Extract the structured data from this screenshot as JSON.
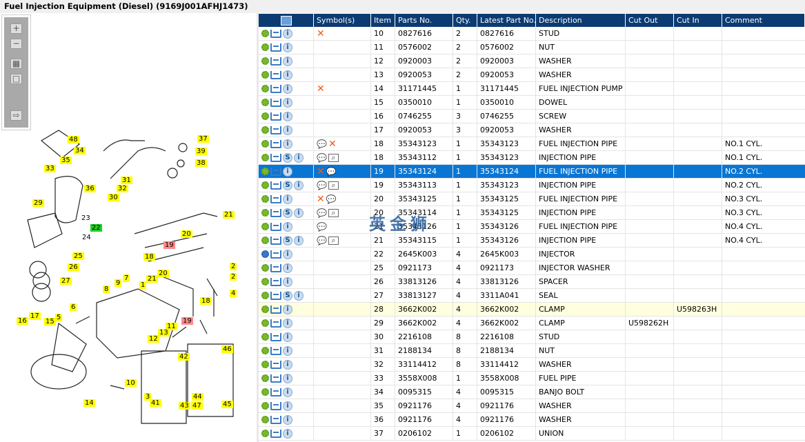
{
  "title": "Fuel Injection Equipment (Diesel) (9169J001AFHJ1473)",
  "toolbar": {
    "zoom_in": "+",
    "zoom_out": "−",
    "fit": "▦",
    "actual": "□",
    "export": "⇨"
  },
  "callouts": [
    "48",
    "34",
    "35",
    "33",
    "37",
    "39",
    "38",
    "31",
    "32",
    "36",
    "30",
    "29",
    "23",
    "22",
    "24",
    "21",
    "20",
    "19",
    "18",
    "25",
    "26",
    "27",
    "2",
    "2",
    "4",
    "7",
    "9",
    "8",
    "1",
    "21",
    "20",
    "18",
    "6",
    "17",
    "16",
    "15",
    "5",
    "19",
    "11",
    "13",
    "12",
    "10",
    "14",
    "42",
    "46",
    "3",
    "41",
    "44",
    "47",
    "45",
    "43"
  ],
  "columns": [
    "",
    "Symbol(s)",
    "Item",
    "Parts No.",
    "Qty.",
    "Latest Part No.",
    "Description",
    "Cut Out",
    "Cut In",
    "Comment"
  ],
  "rows": [
    {
      "icons": "g,c,i",
      "sym": "x",
      "item": "10",
      "part": "0827616",
      "qty": "2",
      "latest": "0827616",
      "desc": "STUD",
      "out": "",
      "in": "",
      "comment": ""
    },
    {
      "icons": "g,c,i",
      "sym": "",
      "item": "11",
      "part": "0576002",
      "qty": "2",
      "latest": "0576002",
      "desc": "NUT",
      "out": "",
      "in": "",
      "comment": ""
    },
    {
      "icons": "g,c,i",
      "sym": "",
      "item": "12",
      "part": "0920003",
      "qty": "2",
      "latest": "0920003",
      "desc": "WASHER",
      "out": "",
      "in": "",
      "comment": ""
    },
    {
      "icons": "g,c,i",
      "sym": "",
      "item": "13",
      "part": "0920053",
      "qty": "2",
      "latest": "0920053",
      "desc": "WASHER",
      "out": "",
      "in": "",
      "comment": ""
    },
    {
      "icons": "g,c,i",
      "sym": "x",
      "item": "14",
      "part": "31171445",
      "qty": "1",
      "latest": "31171445",
      "desc": "FUEL INJECTION PUMP G",
      "out": "",
      "in": "",
      "comment": ""
    },
    {
      "icons": "g,c,i",
      "sym": "",
      "item": "15",
      "part": "0350010",
      "qty": "1",
      "latest": "0350010",
      "desc": "DOWEL",
      "out": "",
      "in": "",
      "comment": ""
    },
    {
      "icons": "g,c,i",
      "sym": "",
      "item": "16",
      "part": "0746255",
      "qty": "3",
      "latest": "0746255",
      "desc": "SCREW",
      "out": "",
      "in": "",
      "comment": ""
    },
    {
      "icons": "g,c,i",
      "sym": "",
      "item": "17",
      "part": "0920053",
      "qty": "3",
      "latest": "0920053",
      "desc": "WASHER",
      "out": "",
      "in": "",
      "comment": ""
    },
    {
      "icons": "g,c,i",
      "sym": "b,x",
      "item": "18",
      "part": "35343123",
      "qty": "1",
      "latest": "35343123",
      "desc": "FUEL INJECTION PIPE",
      "out": "",
      "in": "",
      "comment": "NO.1 CYL."
    },
    {
      "icons": "g,c,s,i",
      "sym": "b,k",
      "item": "18",
      "part": "35343112",
      "qty": "1",
      "latest": "35343123",
      "desc": "INJECTION PIPE",
      "out": "",
      "in": "",
      "comment": "NO.1 CYL."
    },
    {
      "icons": "g,c,i",
      "sym": "x,b",
      "item": "19",
      "part": "35343124",
      "qty": "1",
      "latest": "35343124",
      "desc": "FUEL INJECTION PIPE",
      "out": "",
      "in": "",
      "comment": "NO.2 CYL.",
      "state": "sel"
    },
    {
      "icons": "g,c,s,i",
      "sym": "b,k",
      "item": "19",
      "part": "35343113",
      "qty": "1",
      "latest": "35343123",
      "desc": "INJECTION PIPE",
      "out": "",
      "in": "",
      "comment": "NO.2 CYL."
    },
    {
      "icons": "g,c,i",
      "sym": "x,b",
      "item": "20",
      "part": "35343125",
      "qty": "1",
      "latest": "35343125",
      "desc": "FUEL INJECTION PIPE",
      "out": "",
      "in": "",
      "comment": "NO.3 CYL."
    },
    {
      "icons": "g,c,s,i",
      "sym": "b,k",
      "item": "20",
      "part": "35343114",
      "qty": "1",
      "latest": "35343125",
      "desc": "INJECTION PIPE",
      "out": "",
      "in": "",
      "comment": "NO.3 CYL."
    },
    {
      "icons": "g,c,i",
      "sym": "b",
      "item": "21",
      "part": "35343126",
      "qty": "1",
      "latest": "35343126",
      "desc": "FUEL INJECTION PIPE",
      "out": "",
      "in": "",
      "comment": "NO.4 CYL."
    },
    {
      "icons": "g,c,s,i",
      "sym": "b,k",
      "item": "21",
      "part": "35343115",
      "qty": "1",
      "latest": "35343126",
      "desc": "INJECTION PIPE",
      "out": "",
      "in": "",
      "comment": "NO.4 CYL."
    },
    {
      "icons": "G,c,i",
      "sym": "",
      "item": "22",
      "part": "2645K003",
      "qty": "4",
      "latest": "2645K003",
      "desc": "INJECTOR",
      "out": "",
      "in": "",
      "comment": ""
    },
    {
      "icons": "g,c,i",
      "sym": "",
      "item": "25",
      "part": "0921173",
      "qty": "4",
      "latest": "0921173",
      "desc": "INJECTOR WASHER",
      "out": "",
      "in": "",
      "comment": ""
    },
    {
      "icons": "g,c,i",
      "sym": "",
      "item": "26",
      "part": "33813126",
      "qty": "4",
      "latest": "33813126",
      "desc": "SPACER",
      "out": "",
      "in": "",
      "comment": ""
    },
    {
      "icons": "g,c,s,i",
      "sym": "",
      "item": "27",
      "part": "33813127",
      "qty": "4",
      "latest": "3311A041",
      "desc": "SEAL",
      "out": "",
      "in": "",
      "comment": ""
    },
    {
      "icons": "g,c,i",
      "sym": "",
      "item": "28",
      "part": "3662K002",
      "qty": "4",
      "latest": "3662K002",
      "desc": "CLAMP",
      "out": "",
      "in": "U598263H",
      "comment": "",
      "state": "hl"
    },
    {
      "icons": "g,c,i",
      "sym": "",
      "item": "29",
      "part": "3662K002",
      "qty": "4",
      "latest": "3662K002",
      "desc": "CLAMP",
      "out": "U598262H",
      "in": "",
      "comment": ""
    },
    {
      "icons": "g,c,i",
      "sym": "",
      "item": "30",
      "part": "2216108",
      "qty": "8",
      "latest": "2216108",
      "desc": "STUD",
      "out": "",
      "in": "",
      "comment": ""
    },
    {
      "icons": "g,c,i",
      "sym": "",
      "item": "31",
      "part": "2188134",
      "qty": "8",
      "latest": "2188134",
      "desc": "NUT",
      "out": "",
      "in": "",
      "comment": ""
    },
    {
      "icons": "g,c,i",
      "sym": "",
      "item": "32",
      "part": "33114412",
      "qty": "8",
      "latest": "33114412",
      "desc": "WASHER",
      "out": "",
      "in": "",
      "comment": ""
    },
    {
      "icons": "g,c,i",
      "sym": "",
      "item": "33",
      "part": "3558X008",
      "qty": "1",
      "latest": "3558X008",
      "desc": "FUEL PIPE",
      "out": "",
      "in": "",
      "comment": ""
    },
    {
      "icons": "g,c,i",
      "sym": "",
      "item": "34",
      "part": "0095315",
      "qty": "4",
      "latest": "0095315",
      "desc": "BANJO BOLT",
      "out": "",
      "in": "",
      "comment": ""
    },
    {
      "icons": "g,c,i",
      "sym": "",
      "item": "35",
      "part": "0921176",
      "qty": "4",
      "latest": "0921176",
      "desc": "WASHER",
      "out": "",
      "in": "",
      "comment": ""
    },
    {
      "icons": "g,c,i",
      "sym": "",
      "item": "36",
      "part": "0921176",
      "qty": "4",
      "latest": "0921176",
      "desc": "WASHER",
      "out": "",
      "in": "",
      "comment": ""
    },
    {
      "icons": "g,c,i",
      "sym": "",
      "item": "37",
      "part": "0206102",
      "qty": "1",
      "latest": "0206102",
      "desc": "UNION",
      "out": "",
      "in": "",
      "comment": ""
    }
  ],
  "watermark": "英金狮"
}
